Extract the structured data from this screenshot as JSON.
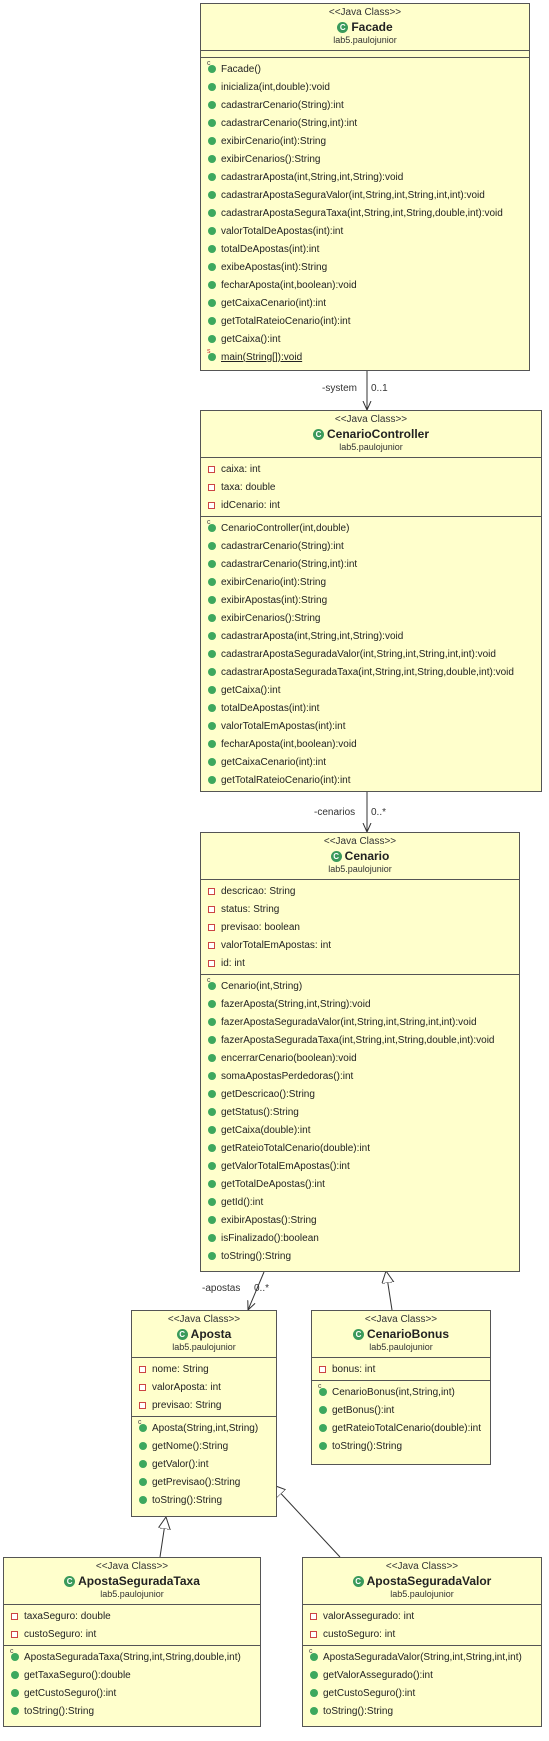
{
  "diagram": {
    "classes": {
      "facade": {
        "stereotype": "<<Java Class>>",
        "name": "Facade",
        "package": "lab5.paulojunior",
        "fields": [],
        "methods": [
          {
            "text": "Facade()",
            "kind": "ctor"
          },
          {
            "text": "inicializa(int,double):void"
          },
          {
            "text": "cadastrarCenario(String):int"
          },
          {
            "text": "cadastrarCenario(String,int):int"
          },
          {
            "text": "exibirCenario(int):String"
          },
          {
            "text": "exibirCenarios():String"
          },
          {
            "text": "cadastrarAposta(int,String,int,String):void"
          },
          {
            "text": "cadastrarApostaSeguraValor(int,String,int,String,int,int):void"
          },
          {
            "text": "cadastrarApostaSeguraTaxa(int,String,int,String,double,int):void"
          },
          {
            "text": "valorTotalDeApostas(int):int"
          },
          {
            "text": "totalDeApostas(int):int"
          },
          {
            "text": "exibeApostas(int):String"
          },
          {
            "text": "fecharAposta(int,boolean):void"
          },
          {
            "text": "getCaixaCenario(int):int"
          },
          {
            "text": "getTotalRateioCenario(int):int"
          },
          {
            "text": "getCaixa():int"
          },
          {
            "text": "main(String[]):void",
            "kind": "static"
          }
        ]
      },
      "cenarioController": {
        "stereotype": "<<Java Class>>",
        "name": "CenarioController",
        "package": "lab5.paulojunior",
        "fields": [
          "caixa: int",
          "taxa: double",
          "idCenario: int"
        ],
        "methods": [
          {
            "text": "CenarioController(int,double)",
            "kind": "ctor"
          },
          {
            "text": "cadastrarCenario(String):int"
          },
          {
            "text": "cadastrarCenario(String,int):int"
          },
          {
            "text": "exibirCenario(int):String"
          },
          {
            "text": "exibirApostas(int):String"
          },
          {
            "text": "exibirCenarios():String"
          },
          {
            "text": "cadastrarAposta(int,String,int,String):void"
          },
          {
            "text": "cadastrarApostaSeguradaValor(int,String,int,String,int,int):void"
          },
          {
            "text": "cadastrarApostaSeguradaTaxa(int,String,int,String,double,int):void"
          },
          {
            "text": "getCaixa():int"
          },
          {
            "text": "totalDeApostas(int):int"
          },
          {
            "text": "valorTotalEmApostas(int):int"
          },
          {
            "text": "fecharAposta(int,boolean):void"
          },
          {
            "text": "getCaixaCenario(int):int"
          },
          {
            "text": "getTotalRateioCenario(int):int"
          }
        ]
      },
      "cenario": {
        "stereotype": "<<Java Class>>",
        "name": "Cenario",
        "package": "lab5.paulojunior",
        "fields": [
          "descricao: String",
          "status: String",
          "previsao: boolean",
          "valorTotalEmApostas: int",
          "id: int"
        ],
        "methods": [
          {
            "text": "Cenario(int,String)",
            "kind": "ctor"
          },
          {
            "text": "fazerAposta(String,int,String):void"
          },
          {
            "text": "fazerApostaSeguradaValor(int,String,int,String,int,int):void"
          },
          {
            "text": "fazerApostaSeguradaTaxa(int,String,int,String,double,int):void"
          },
          {
            "text": "encerrarCenario(boolean):void"
          },
          {
            "text": "somaApostasPerdedoras():int"
          },
          {
            "text": "getDescricao():String"
          },
          {
            "text": "getStatus():String"
          },
          {
            "text": "getCaixa(double):int"
          },
          {
            "text": "getRateioTotalCenario(double):int"
          },
          {
            "text": "getValorTotalEmApostas():int"
          },
          {
            "text": "getTotalDeApostas():int"
          },
          {
            "text": "getId():int"
          },
          {
            "text": "exibirApostas():String"
          },
          {
            "text": "isFinalizado():boolean"
          },
          {
            "text": "toString():String"
          }
        ]
      },
      "aposta": {
        "stereotype": "<<Java Class>>",
        "name": "Aposta",
        "package": "lab5.paulojunior",
        "fields": [
          "nome: String",
          "valorAposta: int",
          "previsao: String"
        ],
        "methods": [
          {
            "text": "Aposta(String,int,String)",
            "kind": "ctor"
          },
          {
            "text": "getNome():String"
          },
          {
            "text": "getValor():int"
          },
          {
            "text": "getPrevisao():String"
          },
          {
            "text": "toString():String"
          }
        ]
      },
      "cenarioBonus": {
        "stereotype": "<<Java Class>>",
        "name": "CenarioBonus",
        "package": "lab5.paulojunior",
        "fields": [
          "bonus: int"
        ],
        "methods": [
          {
            "text": "CenarioBonus(int,String,int)",
            "kind": "ctor"
          },
          {
            "text": "getBonus():int"
          },
          {
            "text": "getRateioTotalCenario(double):int"
          },
          {
            "text": "toString():String"
          }
        ]
      },
      "apostaSeguradaTaxa": {
        "stereotype": "<<Java Class>>",
        "name": "ApostaSeguradaTaxa",
        "package": "lab5.paulojunior",
        "fields": [
          "taxaSeguro: double",
          "custoSeguro: int"
        ],
        "methods": [
          {
            "text": "ApostaSeguradaTaxa(String,int,String,double,int)",
            "kind": "ctor"
          },
          {
            "text": "getTaxaSeguro():double"
          },
          {
            "text": "getCustoSeguro():int"
          },
          {
            "text": "toString():String"
          }
        ]
      },
      "apostaSeguradaValor": {
        "stereotype": "<<Java Class>>",
        "name": "ApostaSeguradaValor",
        "package": "lab5.paulojunior",
        "fields": [
          "valorAssegurado: int",
          "custoSeguro: int"
        ],
        "methods": [
          {
            "text": "ApostaSeguradaValor(String,int,String,int,int)",
            "kind": "ctor"
          },
          {
            "text": "getValorAssegurado():int"
          },
          {
            "text": "getCustoSeguro():int"
          },
          {
            "text": "toString():String"
          }
        ]
      }
    },
    "associations": {
      "system": {
        "role": "-system",
        "multiplicity": "0..1"
      },
      "cenarios": {
        "role": "-cenarios",
        "multiplicity": "0..*"
      },
      "apostas": {
        "role": "-apostas",
        "multiplicity": "0..*"
      }
    },
    "colors": {
      "class_fill": "#ffffcc",
      "border": "#555555",
      "method_icon": "#3da85e",
      "field_icon": "#cc4444"
    }
  }
}
